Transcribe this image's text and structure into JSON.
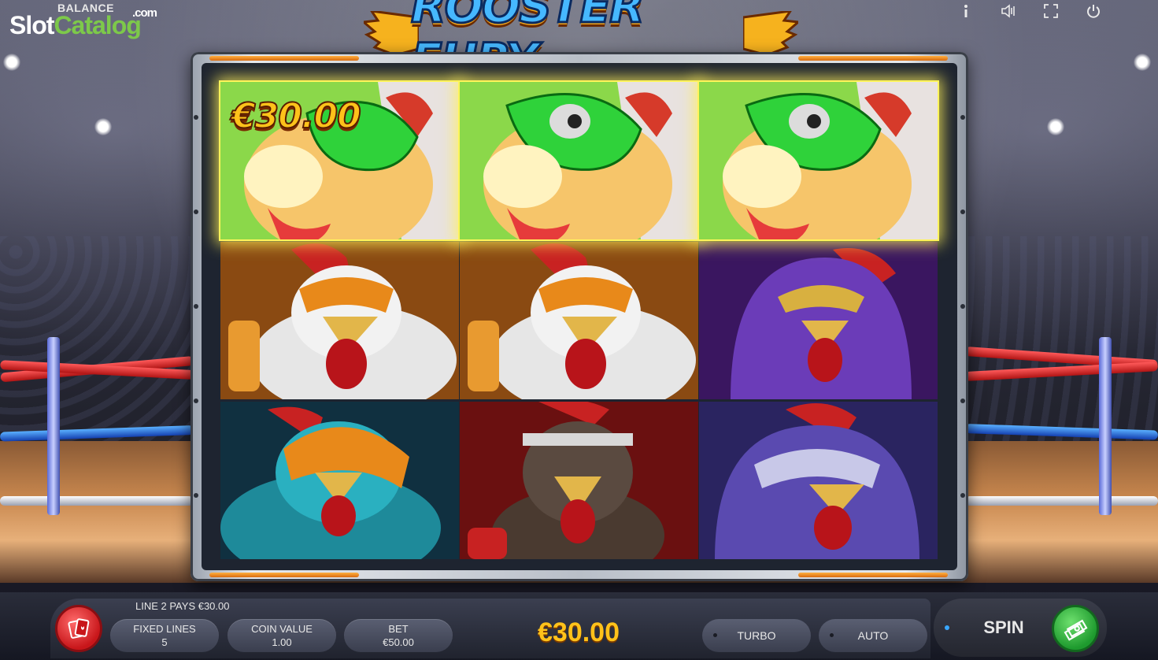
{
  "header": {
    "balance_label": "BALANCE",
    "watermark_part1": "Slot",
    "watermark_part2": "Catalog",
    "watermark_suffix": ".com",
    "logo_text": "ROOSTER FURY",
    "icons": [
      "info-icon",
      "sound-icon",
      "fullscreen-icon",
      "power-icon"
    ]
  },
  "reels": {
    "win_amount": "€30.00",
    "winning_line": 2,
    "grid": [
      [
        "green-mask-rooster",
        "green-mask-rooster",
        "green-mask-rooster"
      ],
      [
        "orange-white-rooster",
        "orange-white-rooster",
        "purple-hood-rooster"
      ],
      [
        "teal-helmet-rooster",
        "red-headband-rooster",
        "blue-mask-rooster"
      ]
    ]
  },
  "controls": {
    "line_pays": "LINE 2 PAYS €30.00",
    "fixed_lines_label": "FIXED LINES",
    "fixed_lines_value": "5",
    "coin_value_label": "COIN VALUE",
    "coin_value": "1.00",
    "bet_label": "BET",
    "bet_value": "€50.00",
    "total_win": "€30.00",
    "turbo_label": "TURBO",
    "auto_label": "AUTO",
    "spin_label": "SPIN"
  },
  "colors": {
    "win_gold": "#ffc21a",
    "highlight": "#fff45a",
    "spin_green": "#1e9a2e",
    "menu_red": "#c8161a"
  }
}
